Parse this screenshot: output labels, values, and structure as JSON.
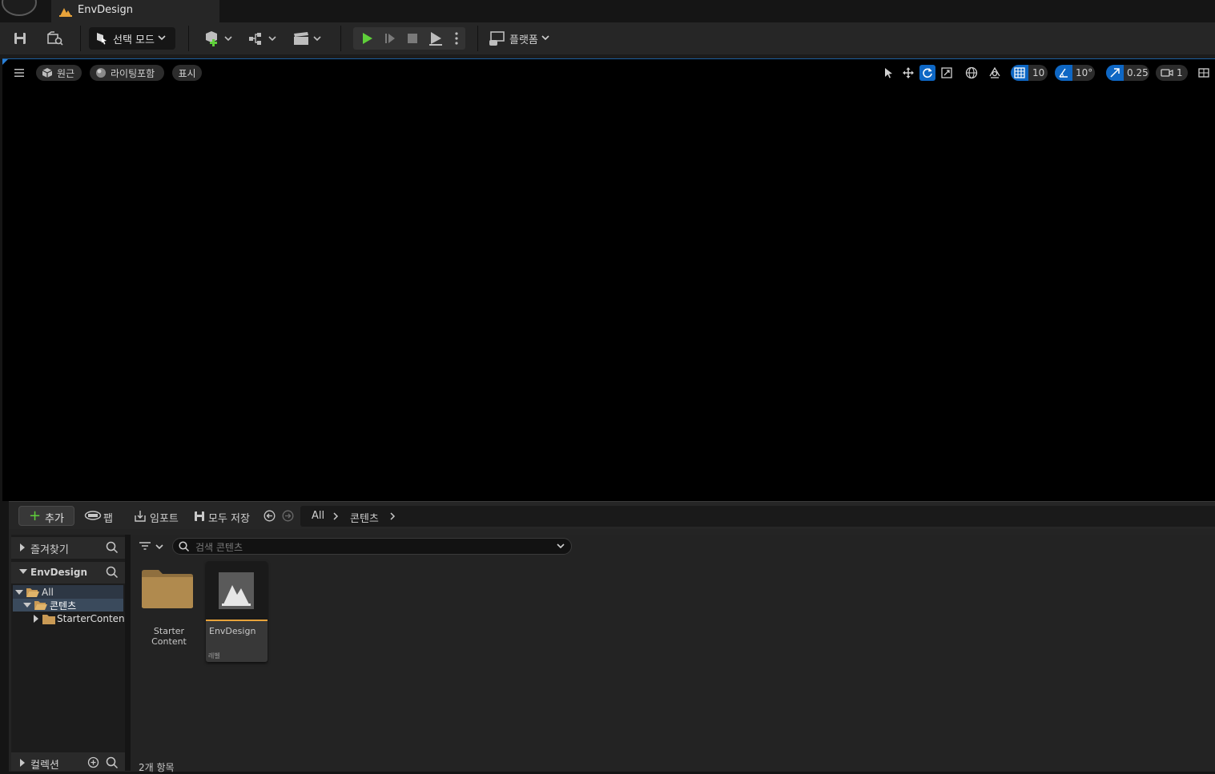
{
  "window": {
    "tab_title": "EnvDesign"
  },
  "toolbar": {
    "mode_label": "선택 모드",
    "platform_label": "플랫폼"
  },
  "viewport": {
    "perspective_label": "원근",
    "lighting_label": "라이팅포함",
    "show_label": "표시",
    "grid_snap_value": "10",
    "rotation_snap_value": "10°",
    "scale_snap_value": "0.25",
    "camera_speed_value": "1"
  },
  "content_browser": {
    "add_label": "추가",
    "fab_label": "팹",
    "import_label": "임포트",
    "save_all_label": "모두 저장",
    "breadcrumb": [
      "All",
      "콘텐츠"
    ],
    "favorites_label": "즐겨찾기",
    "project_label": "EnvDesign",
    "tree": {
      "all": "All",
      "content": "콘텐츠",
      "starter": "StarterContent"
    },
    "collections_label": "컬렉션",
    "search_placeholder": "검색 콘텐츠",
    "items": [
      {
        "name_line1": "Starter",
        "name_line2": "Content",
        "type": "folder"
      },
      {
        "name": "EnvDesign",
        "type_label": "레벨"
      }
    ],
    "item_count": "2개 항목"
  },
  "colors": {
    "accent_blue": "#0e67c4",
    "play_green": "#5fcf3a",
    "level_underline": "#e8a33a",
    "folder_tan": "#b08a4e"
  }
}
